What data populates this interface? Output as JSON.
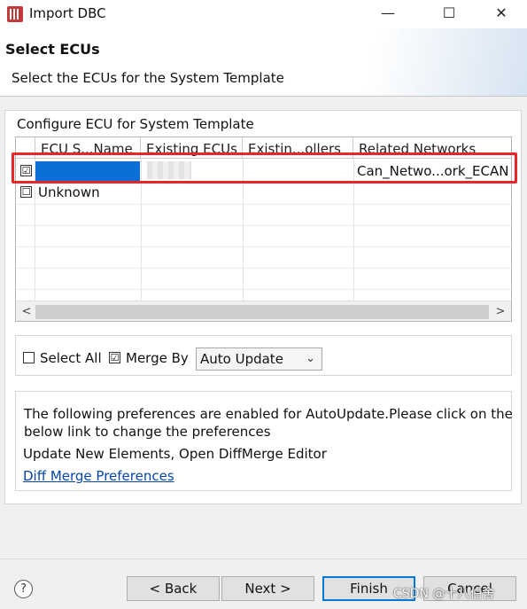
{
  "window": {
    "title": "Import DBC",
    "controls": {
      "minimize": "—",
      "maximize": "☐",
      "close": "✕"
    }
  },
  "header": {
    "title": "Select ECUs",
    "description": "Select the ECUs for the System Template"
  },
  "group": {
    "label": "Configure ECU for System Template",
    "columns": [
      "ECU S...Name",
      "Existing ECUs",
      "Existin...ollers",
      "Related Networks"
    ],
    "rows": [
      {
        "checked": "☑",
        "name": "",
        "existing": "",
        "controllers": "",
        "network": "Can_Netwo...ork_ECAN"
      },
      {
        "checked": "☐",
        "name": "Unknown",
        "existing": "",
        "controllers": "",
        "network": ""
      }
    ],
    "scroll_left": "<",
    "scroll_right": ">"
  },
  "options": {
    "select_all": "Select All",
    "select_all_checked": "☐",
    "merge_by": "Merge By",
    "merge_by_checked": "☑",
    "merge_mode": "Auto Update",
    "dropdown_icon": "chevron-down-icon"
  },
  "info": {
    "line1": "The following preferences are enabled for AutoUpdate.Please click on the",
    "line2": "below link to change the preferences",
    "line3": "Update New Elements, Open DiffMerge Editor",
    "link": "Diff Merge Preferences"
  },
  "footer": {
    "help": "?",
    "back": "< Back",
    "next": "Next >",
    "finish": "Finish",
    "cancel": "Cancel"
  },
  "watermark": "CSDN @十八伯舍",
  "colors": {
    "highlight": "#e8262a",
    "selection": "#0a6fd6",
    "link": "#0645ad",
    "default_button_border": "#0078d7"
  }
}
